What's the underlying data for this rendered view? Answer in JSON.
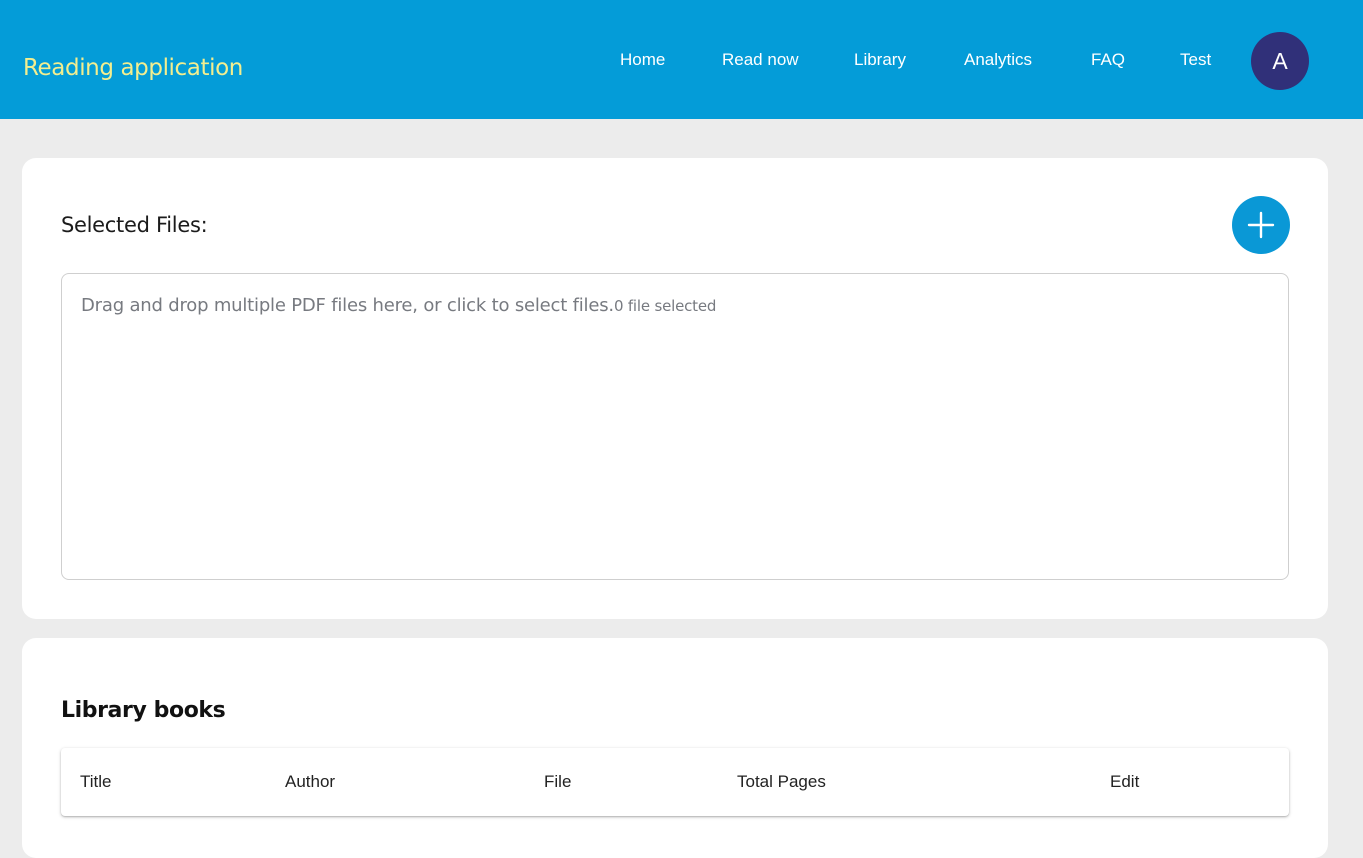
{
  "header": {
    "brand": "Reading application",
    "nav": [
      "Home",
      "Read now",
      "Library",
      "Analytics",
      "FAQ",
      "Test"
    ],
    "avatar_letter": "A"
  },
  "upload": {
    "title": "Selected Files:",
    "add_button_icon": "plus-icon",
    "dropzone_text": "Drag and drop multiple PDF files here, or click to select files.",
    "file_count_text": "0 file selected"
  },
  "library": {
    "title": "Library books",
    "columns": [
      "Title",
      "Author",
      "File",
      "Total Pages",
      "Edit"
    ]
  },
  "colors": {
    "header_bg": "#049cd8",
    "brand_text": "#f3ee8f",
    "avatar_bg": "#303079",
    "accent": "#0a98d6",
    "page_bg": "#ececec"
  }
}
